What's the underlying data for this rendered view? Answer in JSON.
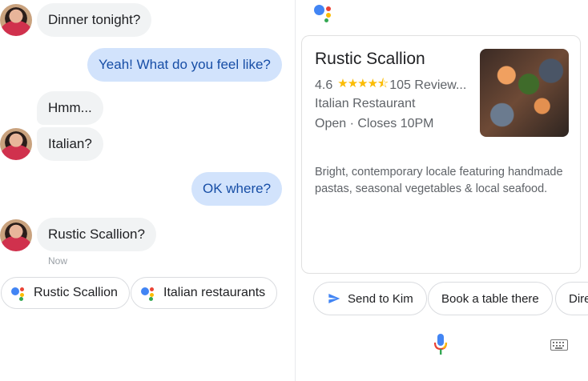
{
  "chat": {
    "messages": [
      {
        "from": "contact",
        "text": "Dinner tonight?"
      },
      {
        "from": "me",
        "text": "Yeah! What do you feel like?"
      },
      {
        "from": "contact",
        "text": "Hmm..."
      },
      {
        "from": "contact",
        "text": "Italian?"
      },
      {
        "from": "me",
        "text": "OK where?"
      },
      {
        "from": "contact",
        "text": "Rustic Scallion?"
      }
    ],
    "timestamp": "Now",
    "suggestions": [
      "Rustic Scallion",
      "Italian restaurants"
    ]
  },
  "assistant": {
    "card": {
      "title": "Rustic Scallion",
      "rating": "4.6",
      "stars": 4.5,
      "star_glyphs": "★★★★⯪",
      "reviews": "105 Review...",
      "category": "Italian Restaurant",
      "hours": "Open · Closes 10PM",
      "description": "Bright, contemporary locale featuring handmade pastas, seasonal vegetables & local seafood."
    },
    "actions": [
      "Send to Kim",
      "Book a table there",
      "Dire"
    ]
  },
  "colors": {
    "google_blue": "#4285f4",
    "google_red": "#ea4335",
    "google_yellow": "#fbbc04",
    "google_green": "#34a853",
    "outgoing_bubble": "#d2e3fc",
    "incoming_bubble": "#f1f3f4"
  },
  "icons": {
    "assistant_logo": "google-assistant-icon",
    "send": "send-icon",
    "mic": "microphone-icon",
    "keyboard": "keyboard-icon"
  }
}
